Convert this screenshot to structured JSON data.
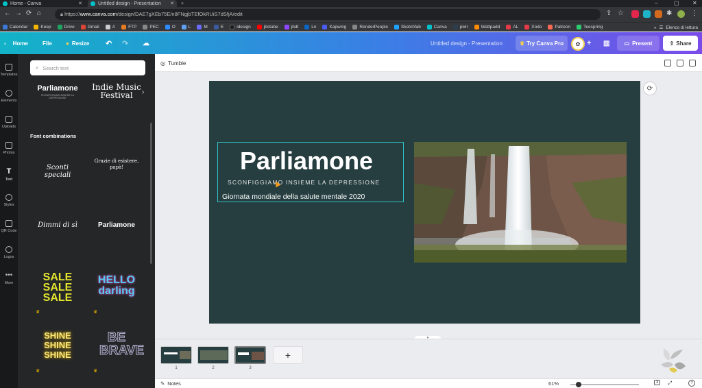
{
  "browser": {
    "tabs": [
      {
        "title": "Home - Canva"
      },
      {
        "title": "Untitled design - Presentation"
      }
    ],
    "new_tab": "+",
    "url_prefix": "https://",
    "url_host": "www.canva.com",
    "url_path": "/design/DAE7gXEb75E/n8FNgjbTEfOkRUiS7dSfjA/edit",
    "bookmarks": [
      "Calendar",
      "Keep",
      "Drive",
      "Gmail",
      "A",
      "FTP",
      "PEC",
      "O",
      "L",
      "M",
      "E",
      "idesign",
      "jbstube",
      "jbdt",
      "Ln",
      "Kapwing",
      "RenderPeople",
      "Sketchfab",
      "Canva",
      "pixlr",
      "Wattpadd",
      "AL",
      "Xodo",
      "Patreon",
      "Teespring"
    ],
    "bookmarks_more": "»",
    "reading_list": "Elenco di lettura"
  },
  "topbar": {
    "home": "Home",
    "file": "File",
    "resize": "Resize",
    "doc_title": "Untitled design - Presentation",
    "try_pro": "Try Canva Pro",
    "present": "Present",
    "share": "Share"
  },
  "rail": [
    {
      "label": "Templates"
    },
    {
      "label": "Elements"
    },
    {
      "label": "Uploads"
    },
    {
      "label": "Photos"
    },
    {
      "label": "Text"
    },
    {
      "label": "Styles"
    },
    {
      "label": "QR Code"
    },
    {
      "label": "Logos"
    },
    {
      "label": "More"
    }
  ],
  "panel": {
    "search_placeholder": "Search text",
    "t1_title": "Parliamone",
    "t1_sub": "SCONFIGGIAMO INSIEME LA DEPRESSIONE",
    "t2_title": "Indie Music Festival",
    "heading": "Font combinations",
    "c1_title": "Sconti speciali",
    "c2_title": "Grazie di esistere, papà!",
    "c3_title": "Dimmi di sì",
    "c4_title": "Parliamone",
    "c5_title": "SALE SALE SALE",
    "c6_title": "HELLO darling",
    "c7_title": "SHINE SHINE SHINE",
    "c8_title": "BE BRAVE"
  },
  "context_bar": {
    "tumble": "Tumble"
  },
  "slide": {
    "title": "Parliamone",
    "subtitle": "SCONFIGGIAMO INSIEME LA DEPRESSIONE",
    "caption": "Giornata mondiale della salute mentale 2020",
    "background": "#263e40",
    "selection_color": "#2fc4c8"
  },
  "pages": {
    "items": [
      "1",
      "2",
      "3"
    ],
    "add": "+"
  },
  "footer": {
    "notes": "Notes",
    "zoom": "61%",
    "page_count": "3"
  }
}
